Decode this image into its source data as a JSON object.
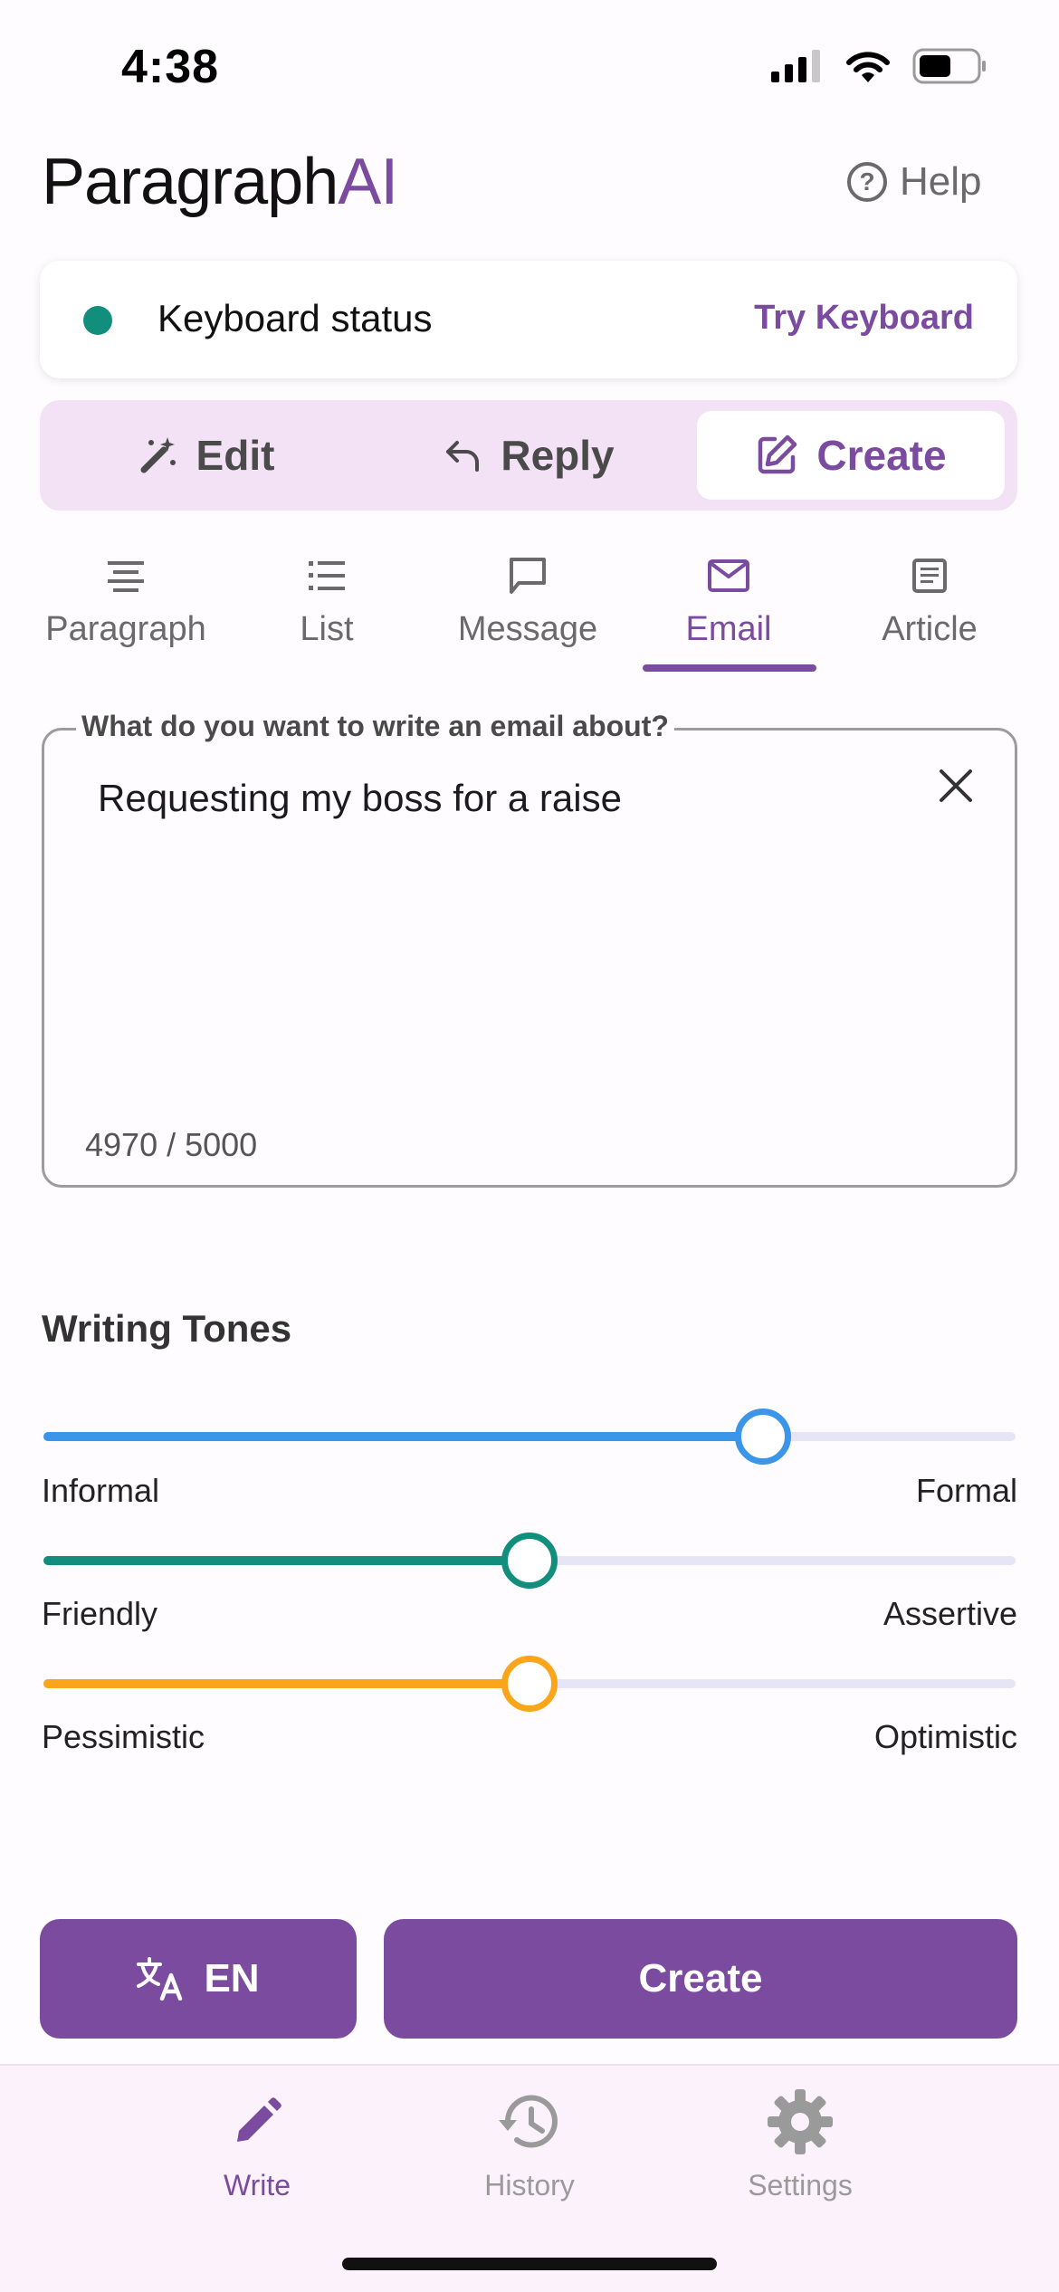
{
  "status_bar": {
    "time": "4:38"
  },
  "header": {
    "logo_main": "Paragraph",
    "logo_accent": "AI",
    "help_label": "Help"
  },
  "keyboard_card": {
    "label": "Keyboard status",
    "action": "Try Keyboard",
    "status_color": "#128E7D"
  },
  "modes": [
    {
      "label": "Edit",
      "icon": "magic-wand-icon"
    },
    {
      "label": "Reply",
      "icon": "reply-arrow-icon"
    },
    {
      "label": "Create",
      "icon": "edit-square-icon",
      "active": true
    }
  ],
  "types": [
    {
      "label": "Paragraph",
      "icon": "align-center-icon"
    },
    {
      "label": "List",
      "icon": "list-icon"
    },
    {
      "label": "Message",
      "icon": "chat-bubble-icon"
    },
    {
      "label": "Email",
      "icon": "mail-icon",
      "active": true
    },
    {
      "label": "Article",
      "icon": "article-icon"
    }
  ],
  "prompt": {
    "legend": "What do you want to write an email about?",
    "value": "Requesting my boss for a raise",
    "counter": "4970 / 5000"
  },
  "tones": {
    "title": "Writing Tones",
    "sliders": [
      {
        "left": "Informal",
        "right": "Formal",
        "value": 0.74,
        "color": "#3B95E8"
      },
      {
        "left": "Friendly",
        "right": "Assertive",
        "value": 0.5,
        "color": "#128E7D"
      },
      {
        "left": "Pessimistic",
        "right": "Optimistic",
        "value": 0.5,
        "color": "#FBA61A"
      }
    ]
  },
  "actions": {
    "language": "EN",
    "create": "Create"
  },
  "bottom_nav": [
    {
      "label": "Write",
      "icon": "pencil-icon",
      "active": true
    },
    {
      "label": "History",
      "icon": "history-icon"
    },
    {
      "label": "Settings",
      "icon": "gear-icon"
    }
  ],
  "colors": {
    "accent": "#7B4BA0",
    "segment_bg": "#F3E1F5"
  }
}
